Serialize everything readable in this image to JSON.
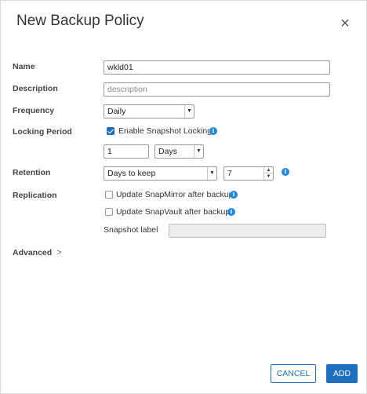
{
  "dialog": {
    "title": "New Backup Policy",
    "close_icon": "×"
  },
  "form": {
    "name": {
      "label": "Name",
      "value": "wkld01"
    },
    "description": {
      "label": "Description",
      "placeholder": "description"
    },
    "frequency": {
      "label": "Frequency",
      "selected": "Daily"
    },
    "locking": {
      "label": "Locking Period",
      "enable_label": "Enable Snapshot Locking",
      "enabled": true,
      "period_value": "1",
      "period_unit": "Days"
    },
    "retention": {
      "label": "Retention",
      "mode": "Days to keep",
      "value": "7"
    },
    "replication": {
      "label": "Replication",
      "snapmirror_label": "Update SnapMirror after backup",
      "snapmirror_checked": false,
      "snapvault_label": "Update SnapVault after backup",
      "snapvault_checked": false,
      "snapshot_label": "Snapshot label"
    }
  },
  "advanced": {
    "label": "Advanced",
    "chevron": ">"
  },
  "buttons": {
    "cancel": "CANCEL",
    "add": "ADD"
  },
  "colors": {
    "accent": "#1e6ec1",
    "info": "#1e88e5"
  }
}
